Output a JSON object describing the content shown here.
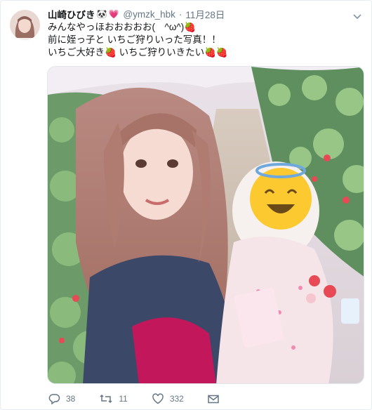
{
  "tweet": {
    "author_name": "山崎ひびき",
    "author_badge": "🐼",
    "author_heart": "💗",
    "handle": "@ymzk_hbk",
    "separator": "·",
    "timestamp": "11月28日",
    "lines": [
      "みんなやっほおおおおお(　^ω^)",
      "前に姪っ子と いちご狩りいった写真！！",
      "いちご大好き",
      " いちご狩りいきたい"
    ],
    "strawberry_emoji": "🍓"
  },
  "actions": {
    "reply_count": "38",
    "retweet_count": "11",
    "like_count": "332"
  },
  "icons": {
    "reply": "reply-icon",
    "retweet": "retweet-icon",
    "like": "heart-icon",
    "dm": "envelope-icon",
    "caret": "chevron-down-icon"
  },
  "colors": {
    "text": "#14171a",
    "muted": "#657786",
    "border": "#e6ecf0",
    "strawberry": "#e0245e"
  }
}
